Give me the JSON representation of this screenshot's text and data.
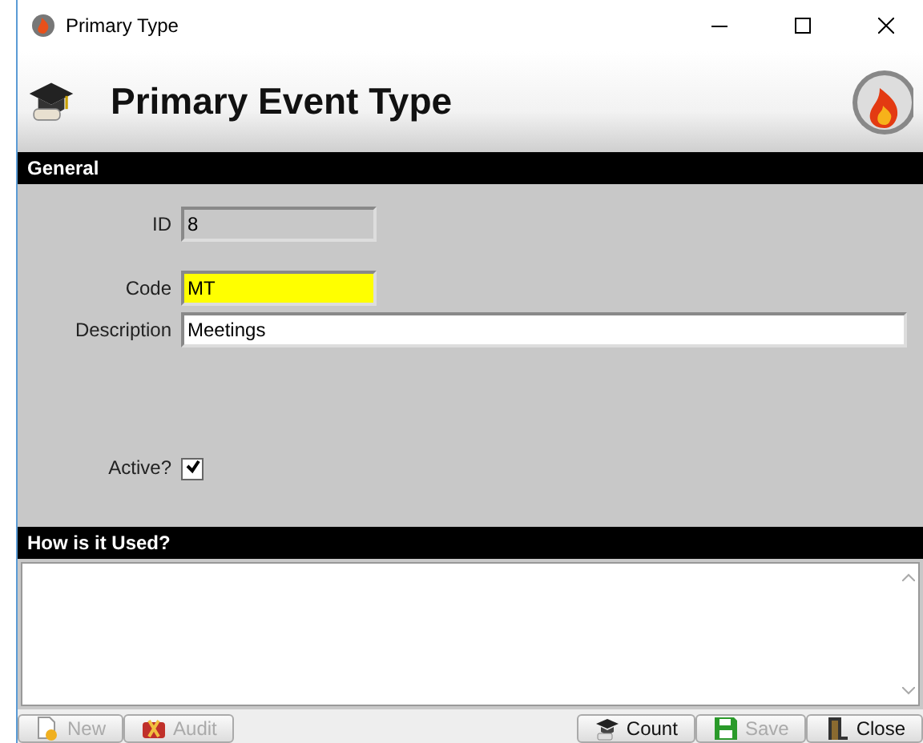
{
  "window": {
    "title": "Primary Type"
  },
  "header": {
    "title": "Primary Event Type"
  },
  "general": {
    "heading": "General",
    "fields": [
      {
        "label": "ID",
        "value": "8",
        "kind": "readonly"
      },
      {
        "label": "Code",
        "value": "MT",
        "kind": "highlight"
      },
      {
        "label": "Description",
        "value": "Meetings",
        "kind": "wide"
      }
    ],
    "active": {
      "label": "Active?",
      "checked": true
    }
  },
  "usage": {
    "heading": "How is it Used?"
  },
  "buttons": [
    {
      "label": "New",
      "kind": "new",
      "disabled": true
    },
    {
      "label": "Audit",
      "kind": "audit",
      "disabled": true
    },
    {
      "label": "Count",
      "kind": "count",
      "disabled": false
    },
    {
      "label": "Save",
      "kind": "save",
      "disabled": true
    },
    {
      "label": "Close",
      "kind": "close",
      "disabled": false
    }
  ]
}
